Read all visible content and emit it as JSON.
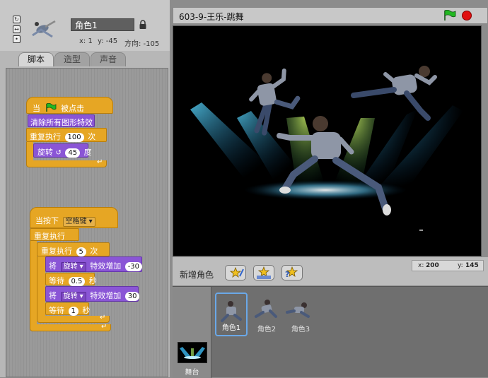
{
  "sprite": {
    "name": "角色1",
    "x_label": "x: 1",
    "y_label": "y: -45",
    "direction_label": "方向: -105"
  },
  "tabs": [
    {
      "label": "脚本",
      "active": true
    },
    {
      "label": "造型",
      "active": false
    },
    {
      "label": "声音",
      "active": false
    }
  ],
  "scripts": {
    "script1": {
      "hat_prefix": "当",
      "hat_suffix": "被点击",
      "clear_effects": "清除所有图形特效",
      "repeat_label": "重复执行",
      "repeat_count": "100",
      "repeat_suffix": "次",
      "turn_label": "旋转",
      "turn_degrees": "45",
      "turn_suffix": "度"
    },
    "script2": {
      "hat_label": "当按下",
      "hat_key": "空格键",
      "forever_label": "重复执行",
      "repeat_label": "重复执行",
      "repeat_count": "5",
      "repeat_suffix": "次",
      "change1_prefix": "将",
      "change1_effect": "旋转",
      "change1_mid": "特效增加",
      "change1_value": "-30",
      "wait1_prefix": "等待",
      "wait1_value": "0.5",
      "wait1_suffix": "秒",
      "change2_prefix": "将",
      "change2_effect": "旋转",
      "change2_mid": "特效增加",
      "change2_value": "30",
      "wait2_prefix": "等待",
      "wait2_value": "1",
      "wait2_suffix": "秒"
    }
  },
  "stage": {
    "project_title": "603-9-王乐-跳舞"
  },
  "stage_bottom": {
    "new_sprite_label": "新增角色",
    "mouse_x_label": "x:",
    "mouse_x": "200",
    "mouse_y_label": "y:",
    "mouse_y": "145"
  },
  "sprite_list": {
    "stage_label": "舞台",
    "sprites": [
      {
        "name": "角色1",
        "selected": true
      },
      {
        "name": "角色2",
        "selected": false
      },
      {
        "name": "角色3",
        "selected": false
      }
    ]
  },
  "colors": {
    "control_block": "#e6a624",
    "looks_block": "#8a55d6",
    "selection_border": "#6aa8e8",
    "stop_red": "#e01010",
    "flag_green": "#22b822"
  }
}
